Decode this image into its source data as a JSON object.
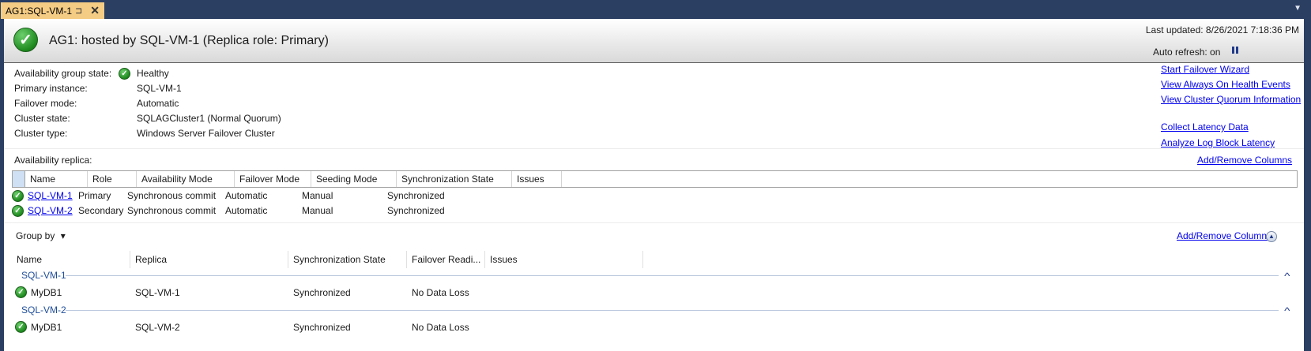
{
  "tab": {
    "title": "AG1:SQL-VM-1",
    "pin_glyph": "⊐",
    "close_glyph": "✕",
    "menu_glyph": "▼"
  },
  "header": {
    "title": "AG1: hosted by SQL-VM-1 (Replica role: Primary)",
    "last_updated": "Last updated: 8/26/2021 7:18:36 PM",
    "auto_refresh": "Auto refresh: on",
    "status_icon": "check-circle-icon"
  },
  "summary": [
    {
      "label": "Availability group state:",
      "value": "Healthy",
      "icon": "check-circle-icon"
    },
    {
      "label": "Primary instance:",
      "value": "SQL-VM-1"
    },
    {
      "label": "Failover mode:",
      "value": "Automatic"
    },
    {
      "label": "Cluster state:",
      "value": "SQLAGCluster1 (Normal Quorum)"
    },
    {
      "label": "Cluster type:",
      "value": "Windows Server Failover Cluster"
    }
  ],
  "links": {
    "start_failover": "Start Failover Wizard",
    "view_health_events": "View Always On Health Events",
    "view_quorum": "View Cluster Quorum Information",
    "collect_latency": "Collect Latency Data",
    "analyze_log_block": "Analyze Log Block Latency"
  },
  "replicas": {
    "section_label": "Availability replica:",
    "add_remove_columns": "Add/Remove Columns",
    "columns": [
      "Name",
      "Role",
      "Availability Mode",
      "Failover Mode",
      "Seeding Mode",
      "Synchronization State",
      "Issues"
    ],
    "rows": [
      {
        "name": "SQL-VM-1",
        "role": "Primary",
        "availability_mode": "Synchronous commit",
        "failover_mode": "Automatic",
        "seeding_mode": "Manual",
        "sync_state": "Synchronized",
        "issues": ""
      },
      {
        "name": "SQL-VM-2",
        "role": "Secondary",
        "availability_mode": "Synchronous commit",
        "failover_mode": "Automatic",
        "seeding_mode": "Manual",
        "sync_state": "Synchronized",
        "issues": ""
      }
    ]
  },
  "databases": {
    "group_by": "Group by",
    "group_by_glyph": "▾",
    "add_remove_columns": "Add/Remove Columns",
    "collapse_glyph": "▲",
    "columns": [
      "Name",
      "Replica",
      "Synchronization State",
      "Failover Readi...",
      "Issues"
    ],
    "groups": [
      {
        "name": "SQL-VM-1",
        "chevron": "^",
        "rows": [
          {
            "name": "MyDB1",
            "replica": "SQL-VM-1",
            "sync_state": "Synchronized",
            "failover_readiness": "No Data Loss",
            "issues": ""
          }
        ]
      },
      {
        "name": "SQL-VM-2",
        "chevron": "^",
        "rows": [
          {
            "name": "MyDB1",
            "replica": "SQL-VM-2",
            "sync_state": "Synchronized",
            "failover_readiness": "No Data Loss",
            "issues": ""
          }
        ]
      }
    ]
  },
  "colors": {
    "chrome": "#2b3f63",
    "tab_active": "#f5cc84",
    "link": "#0000ee",
    "group_text": "#1f4e9a"
  }
}
